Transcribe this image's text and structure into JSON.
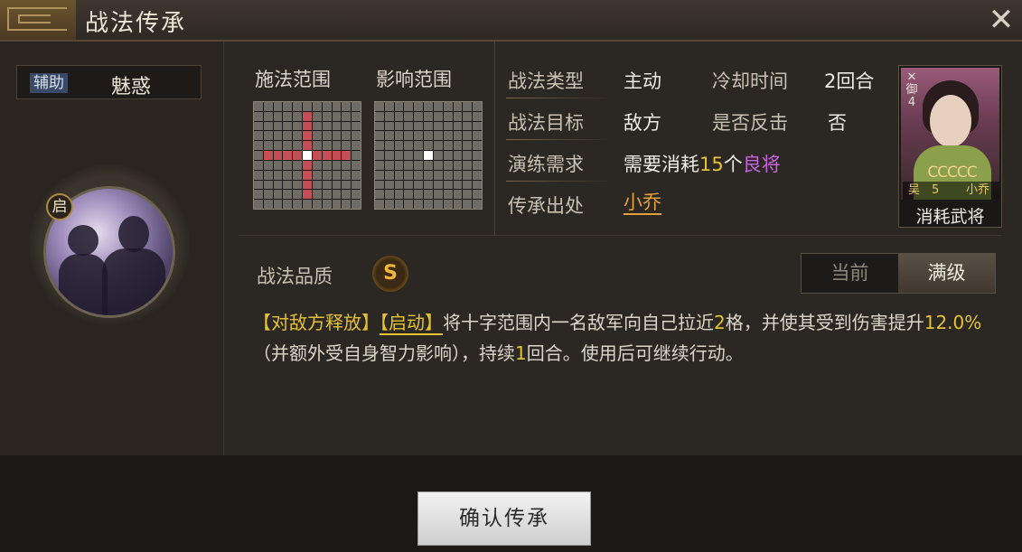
{
  "header": {
    "title": "战法传承",
    "close_icon": "close-icon"
  },
  "left": {
    "type_tag": "辅助",
    "skill_name": "魅惑",
    "badge": "启"
  },
  "range": {
    "cast_label": "施法范围",
    "effect_label": "影响范围"
  },
  "info": {
    "type_label": "战法类型",
    "type_value": "主动",
    "cooldown_label": "冷却时间",
    "cooldown_value": "2回合",
    "target_label": "战法目标",
    "target_value": "敌方",
    "counter_label": "是否反击",
    "counter_value": "否",
    "train_label": "演练需求",
    "train_prefix": "需要消耗",
    "train_count": "15",
    "train_unit": "个",
    "train_item": "良将",
    "source_label": "传承出处",
    "source_value": "小乔"
  },
  "card": {
    "corner_icon": "✕",
    "corner_text": "御4",
    "stars": "CCCCC",
    "faction": "吴",
    "level": "5",
    "name": "小乔",
    "caption": "消耗武将"
  },
  "quality": {
    "label": "战法品质",
    "grade": "S"
  },
  "toggle": {
    "current": "当前",
    "max": "满级"
  },
  "desc": {
    "tag1": "【对敌方释放】",
    "tag2": "【启动】",
    "p1": "将十字范围内一名敌军向自己拉近",
    "n1": "2",
    "p2": "格，并使其受到伤害提升",
    "n2": "12.0%",
    "p3": "（并额外受自身智力影响），持续",
    "n3": "1",
    "p4": "回合。使用后可继续行动。"
  },
  "footer": {
    "confirm": "确认传承"
  }
}
